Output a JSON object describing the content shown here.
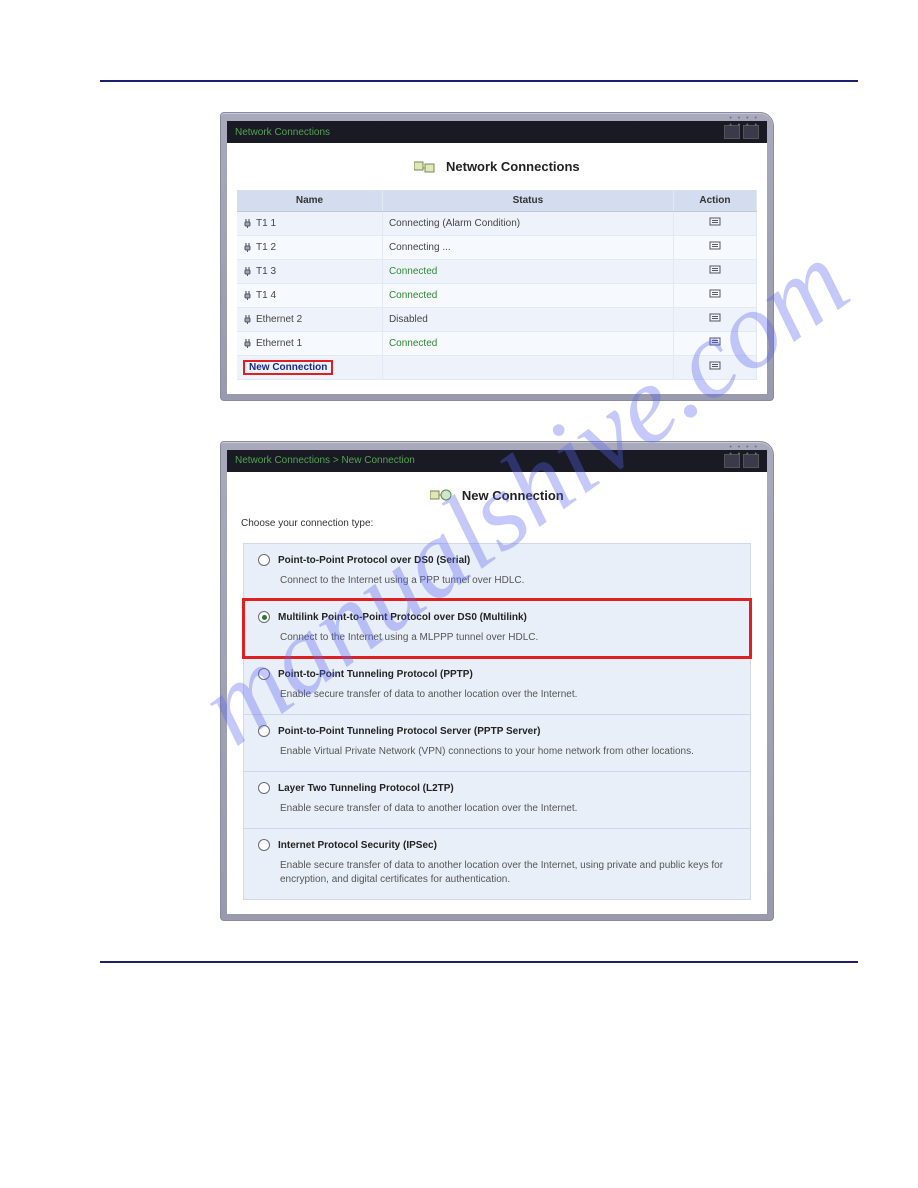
{
  "watermark": "manualshive.com",
  "window1": {
    "breadcrumb": "Network Connections",
    "title": "Network Connections",
    "columns": {
      "name": "Name",
      "status": "Status",
      "action": "Action"
    },
    "rows": [
      {
        "name": "T1 1",
        "status": "Connecting (Alarm Condition)",
        "connected": false
      },
      {
        "name": "T1 2",
        "status": "Connecting ...",
        "connected": false
      },
      {
        "name": "T1 3",
        "status": "Connected",
        "connected": true
      },
      {
        "name": "T1 4",
        "status": "Connected",
        "connected": true
      },
      {
        "name": "Ethernet 2",
        "status": "Disabled",
        "connected": false
      },
      {
        "name": "Ethernet 1",
        "status": "Connected",
        "connected": true
      }
    ],
    "new_connection": "New Connection"
  },
  "window2": {
    "breadcrumb": "Network Connections  >  New Connection",
    "title": "New Connection",
    "instruction": "Choose your connection type:",
    "options": [
      {
        "label": "Point-to-Point Protocol over DS0 (Serial)",
        "desc": "Connect to the Internet using a PPP tunnel over HDLC.",
        "checked": false,
        "highlight": false
      },
      {
        "label": "Multilink Point-to-Point Protocol over DS0 (Multilink)",
        "desc": "Connect to the Internet using a MLPPP tunnel over HDLC.",
        "checked": true,
        "highlight": true
      },
      {
        "label": "Point-to-Point Tunneling Protocol (PPTP)",
        "desc": "Enable secure transfer of data to another location over the Internet.",
        "checked": false,
        "highlight": false
      },
      {
        "label": "Point-to-Point Tunneling Protocol Server (PPTP Server)",
        "desc": "Enable Virtual Private Network (VPN) connections to your home network from other locations.",
        "checked": false,
        "highlight": false
      },
      {
        "label": "Layer Two Tunneling Protocol (L2TP)",
        "desc": "Enable secure transfer of data to another location over the Internet.",
        "checked": false,
        "highlight": false
      },
      {
        "label": "Internet Protocol Security (IPSec)",
        "desc": "Enable secure transfer of data to another location over the Internet, using private and public keys for encryption, and digital certificates for authentication.",
        "checked": false,
        "highlight": false
      }
    ]
  }
}
